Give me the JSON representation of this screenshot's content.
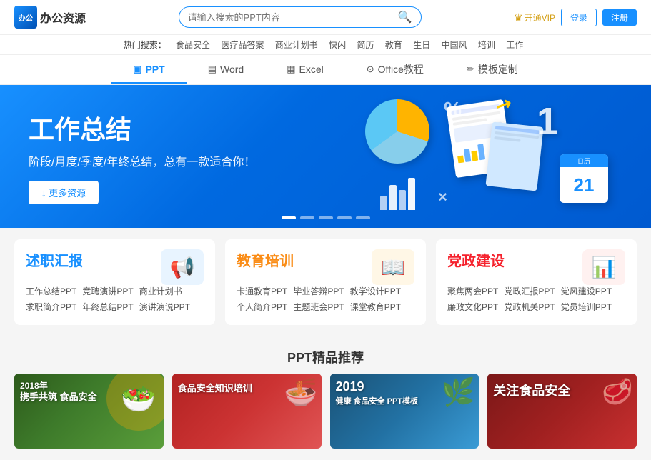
{
  "site": {
    "logo_text": "办公资源",
    "logo_short": "办公"
  },
  "search": {
    "placeholder": "请输入搜索的PPT内容"
  },
  "header": {
    "vip_label": "开通VIP",
    "login_label": "登录",
    "register_label": "注册"
  },
  "hot_search": {
    "prefix": "热门搜索：",
    "items": [
      "食品安全",
      "医疗品答案",
      "商业计划书",
      "快闪",
      "简历",
      "教育",
      "生日",
      "中国风",
      "培训",
      "工作"
    ]
  },
  "nav": {
    "tabs": [
      {
        "id": "ppt",
        "icon": "▣",
        "label": "PPT",
        "active": true
      },
      {
        "id": "word",
        "icon": "▤",
        "label": "Word",
        "active": false
      },
      {
        "id": "excel",
        "icon": "▦",
        "label": "Excel",
        "active": false
      },
      {
        "id": "office",
        "icon": "⊙",
        "label": "Office教程",
        "active": false
      },
      {
        "id": "template",
        "icon": "✏",
        "label": "模板定制",
        "active": false
      }
    ]
  },
  "banner": {
    "title": "工作总结",
    "subtitle": "阶段/月度/季度/年终总结，总有一款适合你！",
    "btn_label": "↓ 更多资源",
    "num": "1",
    "dots": [
      true,
      false,
      false,
      false,
      false
    ]
  },
  "categories": [
    {
      "id": "zv",
      "title": "述职汇报",
      "icon": "📢",
      "links": [
        [
          "工作总结PPT",
          "竞聘演讲PPT",
          "商业计划书"
        ],
        [
          "求职简介PPT",
          "年终总结PPT",
          "演讲演说PPT"
        ]
      ]
    },
    {
      "id": "edu",
      "title": "教育培训",
      "icon": "📖",
      "links": [
        [
          "卡通教育PPT",
          "毕业答辩PPT",
          "教学设计PPT"
        ],
        [
          "个人简介PPT",
          "主题班会PPT",
          "课堂教育PPT"
        ]
      ]
    },
    {
      "id": "party",
      "title": "党政建设",
      "icon": "📊",
      "links": [
        [
          "聚焦两会PPT",
          "党政汇报PPT",
          "党风建设PPT"
        ],
        [
          "廉政文化PPT",
          "党政机关PPT",
          "党员培训PPT"
        ]
      ]
    }
  ],
  "ppt_section": {
    "title": "PPT精品推荐",
    "cards": [
      {
        "id": "food1",
        "year": "2018年",
        "line1": "携手共筑 食品安全",
        "sub": ""
      },
      {
        "id": "food2",
        "line1": "食品安全知识培训",
        "sub": ""
      },
      {
        "id": "food3",
        "year": "2019",
        "line1": "健康 食品安全 PPT模板",
        "sub": ""
      },
      {
        "id": "food4",
        "line1": "关注食品安全",
        "sub": ""
      }
    ]
  },
  "colors": {
    "primary": "#1890ff",
    "accent_orange": "#fa8c16",
    "accent_red": "#f5222d",
    "banner_bg": "#1890ff"
  }
}
